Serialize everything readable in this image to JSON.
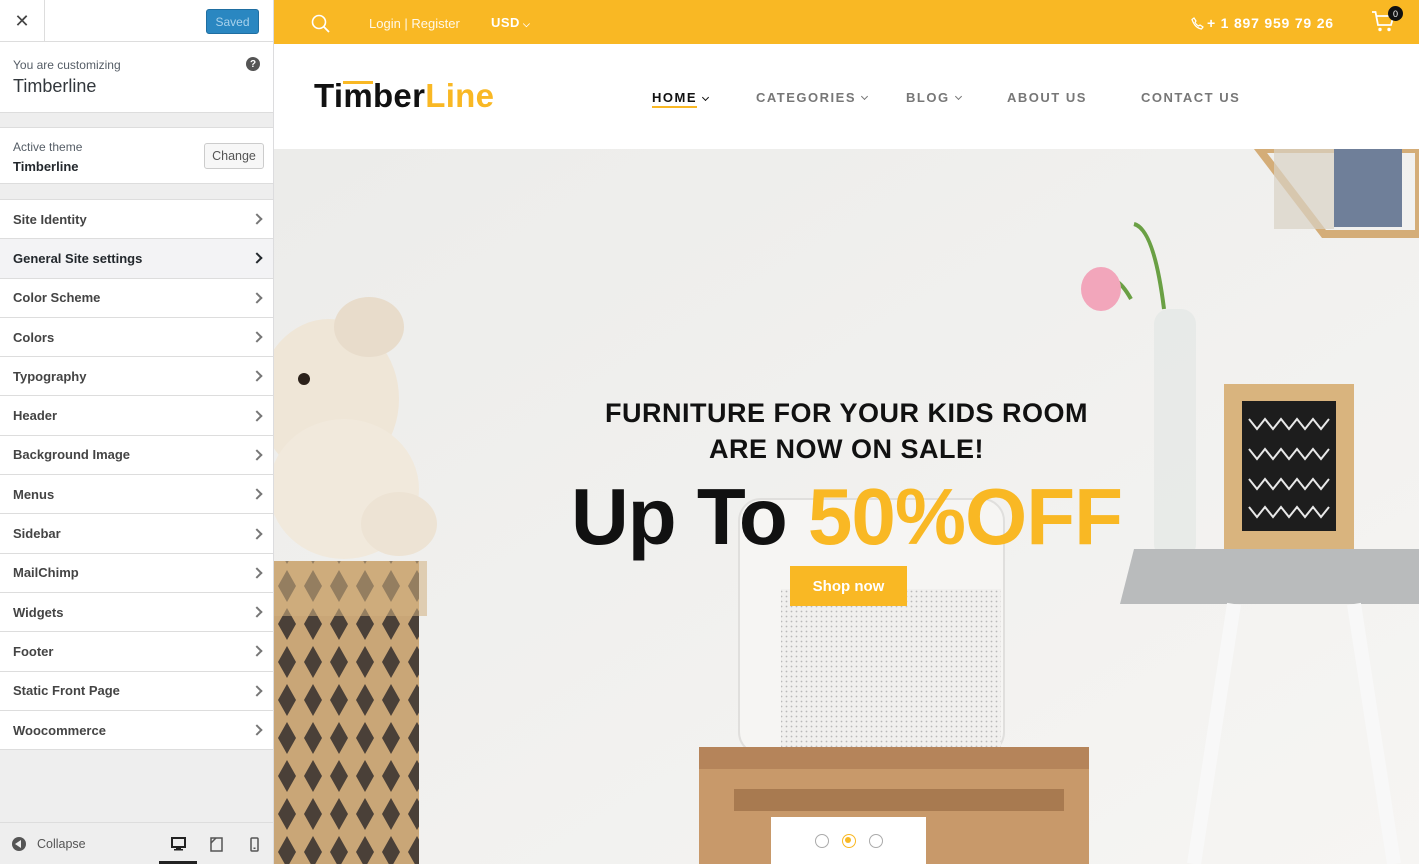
{
  "customizer": {
    "close_icon": "close-icon",
    "saved_label": "Saved",
    "customizing_label": "You are customizing",
    "site_name": "Timberline",
    "active_theme_label": "Active theme",
    "active_theme_name": "Timberline",
    "change_label": "Change",
    "sections": [
      {
        "label": "Site Identity"
      },
      {
        "label": "General Site settings"
      },
      {
        "label": "Color Scheme"
      },
      {
        "label": "Colors"
      },
      {
        "label": "Typography"
      },
      {
        "label": "Header"
      },
      {
        "label": "Background Image"
      },
      {
        "label": "Menus"
      },
      {
        "label": "Sidebar"
      },
      {
        "label": "MailChimp"
      },
      {
        "label": "Widgets"
      },
      {
        "label": "Footer"
      },
      {
        "label": "Static Front Page"
      },
      {
        "label": "Woocommerce"
      }
    ],
    "collapse_label": "Collapse",
    "active_device": "desktop"
  },
  "site": {
    "topbar": {
      "login": "Login | Register",
      "currency": "USD",
      "phone": "+ 1 897 959 79 26",
      "cart_count": "0"
    },
    "logo": {
      "part1": "Timber",
      "part2": "Line"
    },
    "menu": {
      "home": "HOME",
      "categories": "CATEGORIES",
      "blog": "BLOG",
      "about": "ABOUT US",
      "contact": "CONTACT US"
    },
    "hero": {
      "line1": "FURNITURE FOR YOUR KIDS ROOM",
      "line2": "ARE NOW ON SALE!",
      "big_part1": "Up To ",
      "big_part2": "50%OFF",
      "button": "Shop now",
      "active_slide": 2
    }
  },
  "colors": {
    "accent": "#f9b824",
    "wp_blue": "#2a87c1"
  }
}
